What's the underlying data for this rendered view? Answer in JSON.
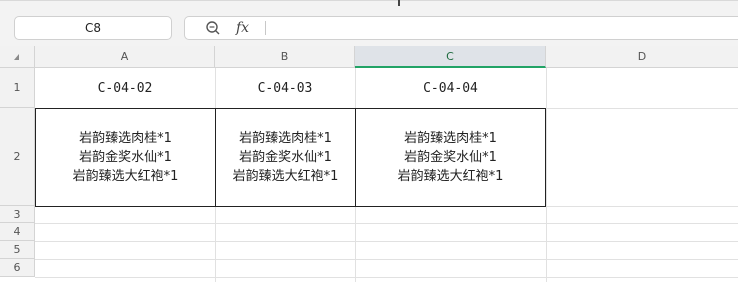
{
  "formula_bar": {
    "name_box": "C8",
    "fx_label": "fx",
    "formula": ""
  },
  "columns": [
    {
      "letter": "A",
      "active": false
    },
    {
      "letter": "B",
      "active": false
    },
    {
      "letter": "C",
      "active": true
    },
    {
      "letter": "D",
      "active": false
    }
  ],
  "rows": [
    "1",
    "2",
    "3",
    "4",
    "5",
    "6"
  ],
  "cells": {
    "A1": "C-04-02",
    "B1": "C-04-03",
    "C1": "C-04-04",
    "A2": [
      "岩韵臻选肉桂*1",
      "岩韵金奖水仙*1",
      "岩韵臻选大红袍*1"
    ],
    "B2": [
      "岩韵臻选肉桂*1",
      "岩韵金奖水仙*1",
      "岩韵臻选大红袍*1"
    ],
    "C2": [
      "岩韵臻选肉桂*1",
      "岩韵金奖水仙*1",
      "岩韵臻选大红袍*1"
    ]
  },
  "colors": {
    "active_column_accent": "#21a366",
    "header_bg": "#f2f2f2",
    "gridline": "#e1e1e1"
  }
}
